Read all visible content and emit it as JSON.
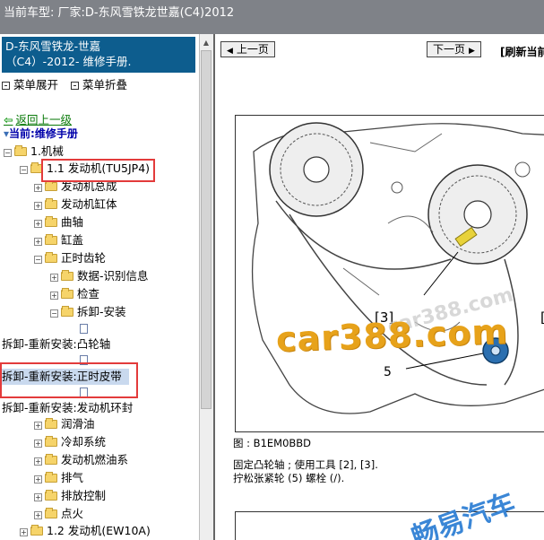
{
  "topbar": {
    "text": "当前车型:   厂家:D-东风雪铁龙世嘉(C4)2012"
  },
  "sidebar": {
    "title_line1": "D-东风雪铁龙-世嘉",
    "title_line2": "（C4）-2012- 维修手册.",
    "expand_label": "菜单展开",
    "collapse_label": "菜单折叠",
    "back_label": "返回上一级",
    "current_label": "当前:维修手册",
    "tree": [
      {
        "label": "1.机械"
      },
      {
        "label": "1.1 发动机(TU5JP4)"
      },
      {
        "label": "发动机总成"
      },
      {
        "label": "发动机缸体"
      },
      {
        "label": "曲轴"
      },
      {
        "label": "缸盖"
      },
      {
        "label": "正时齿轮"
      },
      {
        "label": "数据-识别信息"
      },
      {
        "label": "检查"
      },
      {
        "label": "拆卸-安装"
      },
      {
        "label": "拆卸-重新安装:凸轮轴"
      },
      {
        "label": "拆卸-重新安装:正时皮带"
      },
      {
        "label": "拆卸-重新安装:发动机环封"
      },
      {
        "label": "润滑油"
      },
      {
        "label": "冷却系统"
      },
      {
        "label": "发动机燃油系"
      },
      {
        "label": "排气"
      },
      {
        "label": "排放控制"
      },
      {
        "label": "点火"
      },
      {
        "label": "1.2 发动机(EW10A)"
      }
    ]
  },
  "content": {
    "prev_label": "上一页",
    "next_label": "下一页",
    "refresh_label": "[刷新当前",
    "callout_3": "[3]",
    "callout_5": "5",
    "callout_right": "[",
    "figure_caption": "图 : B1EM0BBD",
    "text_line1": "固定凸轮轴 ; 使用工具 [2], [3].",
    "text_line2": "拧松张紧轮 (5) 螺栓 (/).",
    "watermark_main": "car388.com",
    "watermark_faint": "car388.com",
    "watermark_cn": "畅易汽车"
  },
  "colors": {
    "topbar_bg": "#7f8288",
    "title_bg": "#0d5d8e",
    "highlight_red": "#e33b3b",
    "watermark_orange": "#e7a21a",
    "watermark_blue": "#3a86d6"
  }
}
